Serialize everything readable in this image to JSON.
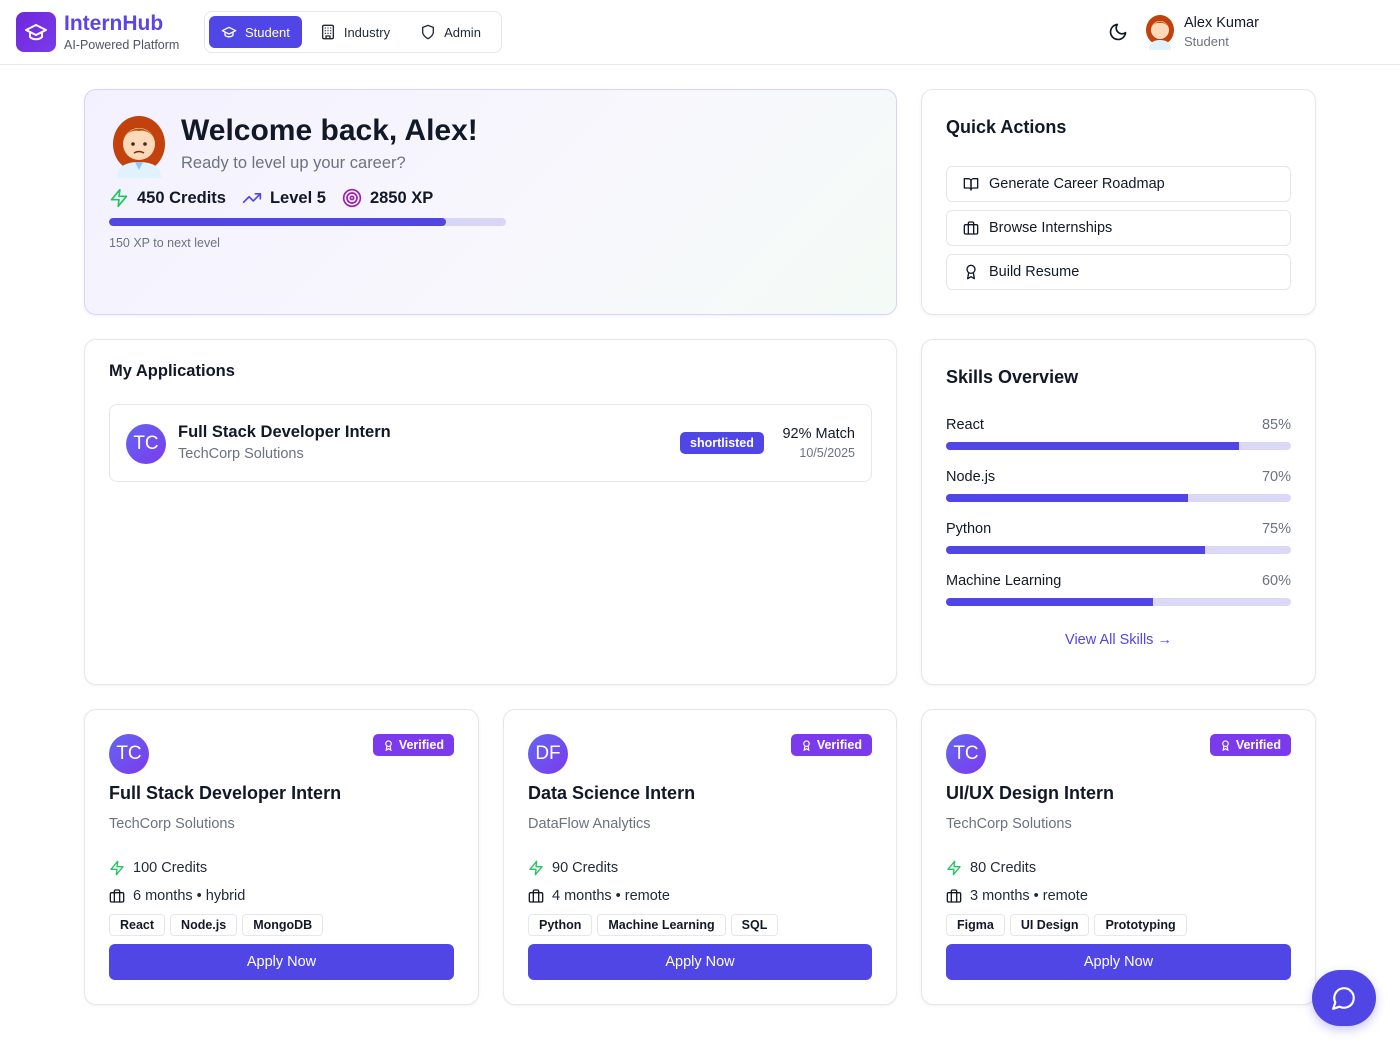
{
  "header": {
    "brand_name": "InternHub",
    "brand_sub": "AI-Powered Platform",
    "roles": [
      {
        "label": "Student",
        "icon": "graduation-cap-icon",
        "active": true
      },
      {
        "label": "Industry",
        "icon": "building-icon",
        "active": false
      },
      {
        "label": "Admin",
        "icon": "shield-icon",
        "active": false
      }
    ],
    "theme_icon": "moon-icon",
    "user": {
      "name": "Alex Kumar",
      "role": "Student"
    }
  },
  "welcome": {
    "title": "Welcome back, Alex!",
    "subtitle": "Ready to level up your career?",
    "credits": "450 Credits",
    "level": "Level 5",
    "xp": "2850 XP",
    "xp_progress": 0.85,
    "xp_note": "150 XP to next level"
  },
  "quick_actions": {
    "title": "Quick Actions",
    "items": [
      {
        "label": "Generate Career Roadmap",
        "icon": "book-open-icon"
      },
      {
        "label": "Browse Internships",
        "icon": "briefcase-icon"
      },
      {
        "label": "Build Resume",
        "icon": "award-icon"
      }
    ]
  },
  "applications": {
    "title": "My Applications",
    "items": [
      {
        "initials": "TC",
        "title": "Full Stack Developer Intern",
        "company": "TechCorp Solutions",
        "status": "shortlisted",
        "match": "92% Match",
        "date": "10/5/2025"
      }
    ]
  },
  "skills": {
    "title": "Skills Overview",
    "items": [
      {
        "name": "React",
        "pct_label": "85%",
        "value": 85
      },
      {
        "name": "Node.js",
        "pct_label": "70%",
        "value": 70
      },
      {
        "name": "Python",
        "pct_label": "75%",
        "value": 75
      },
      {
        "name": "Machine Learning",
        "pct_label": "60%",
        "value": 60
      }
    ],
    "view_all": "View All Skills →"
  },
  "internships": [
    {
      "initials": "TC",
      "verified": "Verified",
      "title": "Full Stack Developer Intern",
      "company": "TechCorp Solutions",
      "credits": "100 Credits",
      "duration": "6 months • hybrid",
      "tags": [
        "React",
        "Node.js",
        "MongoDB"
      ],
      "apply": "Apply Now"
    },
    {
      "initials": "DF",
      "verified": "Verified",
      "title": "Data Science Intern",
      "company": "DataFlow Analytics",
      "credits": "90 Credits",
      "duration": "4 months • remote",
      "tags": [
        "Python",
        "Machine Learning",
        "SQL"
      ],
      "apply": "Apply Now"
    },
    {
      "initials": "TC",
      "verified": "Verified",
      "title": "UI/UX Design Intern",
      "company": "TechCorp Solutions",
      "credits": "80 Credits",
      "duration": "3 months • remote",
      "tags": [
        "Figma",
        "UI Design",
        "Prototyping"
      ],
      "apply": "Apply Now"
    }
  ],
  "colors": {
    "accent": "#5046e5",
    "verified": "#7c3aed",
    "credits_green": "#22c55e"
  },
  "chat_icon": "message-circle-icon"
}
